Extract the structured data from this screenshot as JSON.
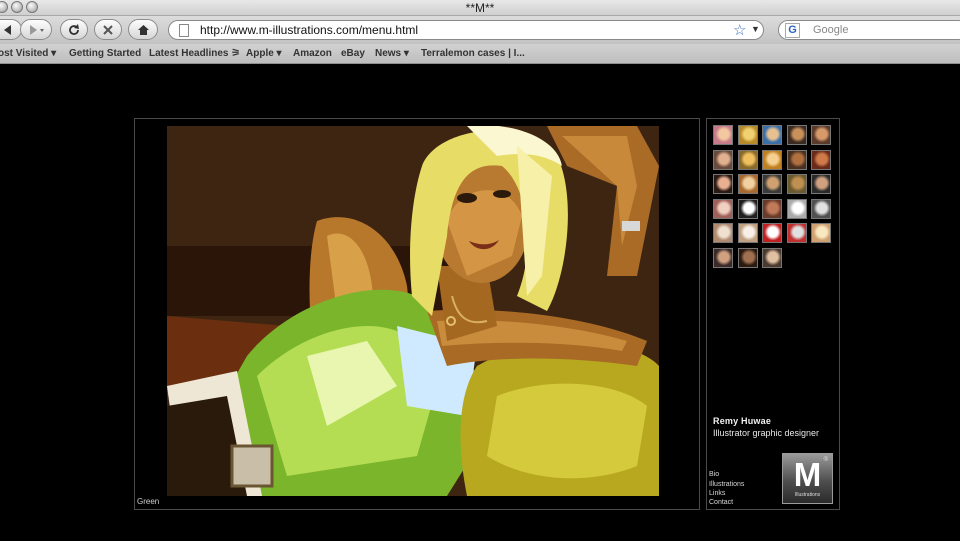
{
  "window": {
    "title": "**M**"
  },
  "toolbar": {
    "url": "http://www.m-illustrations.com/menu.html",
    "search_placeholder": "Google",
    "icons": [
      "back-icon",
      "forward-icon",
      "reload-icon",
      "stop-icon",
      "home-icon",
      "page-icon",
      "bookmark-star-icon",
      "google-icon"
    ]
  },
  "bookmarks": [
    {
      "label": "ost Visited ▾"
    },
    {
      "label": "Getting Started"
    },
    {
      "label": "Latest Headlines ⚞"
    },
    {
      "label": "Apple ▾"
    },
    {
      "label": "Amazon"
    },
    {
      "label": "eBay"
    },
    {
      "label": "News ▾"
    },
    {
      "label": "Terralemon cases | I..."
    }
  ],
  "gallery": {
    "caption": "Green",
    "thumbnail_count": 28
  },
  "profile": {
    "name": "Remy Huwae",
    "role": "Illustrator graphic designer"
  },
  "menu": [
    "Bio",
    "Illustrations",
    "Links",
    "Contact"
  ],
  "logo": {
    "letter": "M",
    "reg": "®",
    "tagline": "Illustrations"
  }
}
